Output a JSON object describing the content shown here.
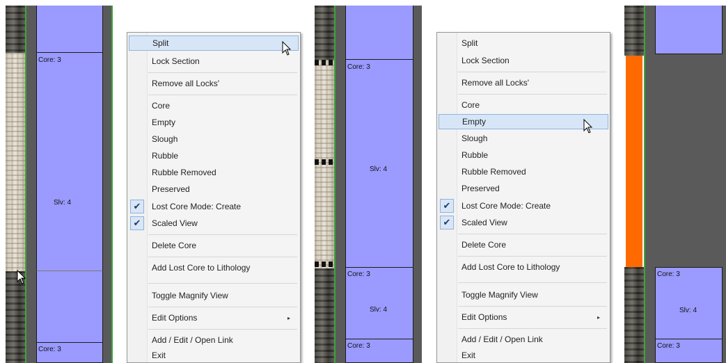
{
  "panel1": {
    "labels": {
      "core_top": "Core: 3",
      "slv": "Slv: 4",
      "core_bottom": "Core: 3"
    }
  },
  "menu1": {
    "items": [
      {
        "label": "Split",
        "highlighted": true
      },
      {
        "label": "Lock Section"
      },
      {
        "label": "Remove all Locks'"
      },
      {
        "label": "Core"
      },
      {
        "label": "Empty"
      },
      {
        "label": "Slough"
      },
      {
        "label": "Rubble"
      },
      {
        "label": "Rubble Removed"
      },
      {
        "label": "Preserved"
      },
      {
        "label": "Lost Core Mode: Create",
        "checked": true
      },
      {
        "label": "Scaled View",
        "checked": true
      },
      {
        "label": "Delete Core"
      },
      {
        "label": "Add Lost Core to Lithology"
      },
      {
        "label": "Toggle Magnify View"
      },
      {
        "label": "Edit Options",
        "submenu": true
      },
      {
        "label": "Add / Edit / Open Link"
      },
      {
        "label": "Exit"
      }
    ]
  },
  "panel2": {
    "labels": {
      "core_top": "Core: 3",
      "slv": "Slv: 4",
      "core_mid": "Core: 3",
      "slv_bottom": "Slv: 4",
      "core_bottom": "Core: 3"
    }
  },
  "menu2": {
    "items": [
      {
        "label": "Split"
      },
      {
        "label": "Lock Section"
      },
      {
        "label": "Remove all Locks'"
      },
      {
        "label": "Core"
      },
      {
        "label": "Empty",
        "highlighted": true
      },
      {
        "label": "Slough"
      },
      {
        "label": "Rubble"
      },
      {
        "label": "Rubble Removed"
      },
      {
        "label": "Preserved"
      },
      {
        "label": "Lost Core Mode: Create",
        "checked": true
      },
      {
        "label": "Scaled View",
        "checked": true
      },
      {
        "label": "Delete Core"
      },
      {
        "label": "Add Lost Core to Lithology"
      },
      {
        "label": "Toggle Magnify View"
      },
      {
        "label": "Edit Options",
        "submenu": true
      },
      {
        "label": "Add / Edit / Open Link"
      },
      {
        "label": "Exit"
      }
    ]
  },
  "panel3": {
    "labels": {
      "core_mid": "Core: 3",
      "slv": "Slv: 4",
      "core_bottom": "Core: 3"
    },
    "empty_color": "#ff6a00"
  },
  "icons": {
    "check": "✔",
    "submenu_arrow": "▸"
  },
  "colors": {
    "block": "#9a9aff",
    "lane": "#5a5a5a",
    "highlight": "#d7e6f7"
  }
}
